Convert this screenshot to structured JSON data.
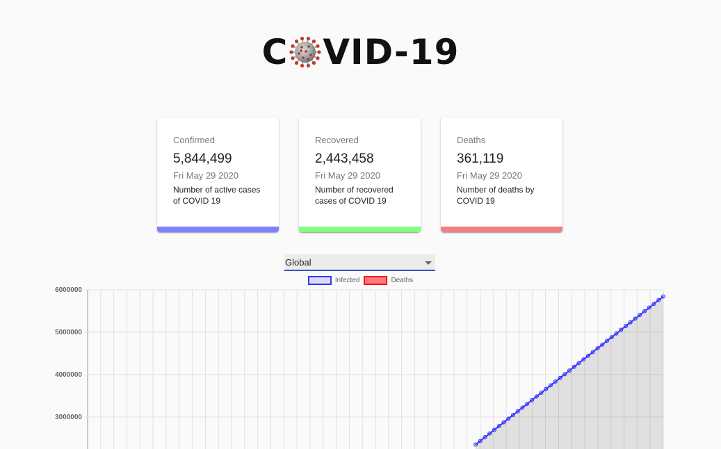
{
  "header": {
    "title_left": "C",
    "title_right": "VID-19",
    "logo_icon": "coronavirus-icon"
  },
  "cards": [
    {
      "title": "Confirmed",
      "value": "5,844,499",
      "date": "Fri May 29 2020",
      "description": "Number of active cases of COVID 19",
      "bar_color": "#8080ff"
    },
    {
      "title": "Recovered",
      "value": "2,443,458",
      "date": "Fri May 29 2020",
      "description": "Number of recovered cases of COVID 19",
      "bar_color": "#80ff80"
    },
    {
      "title": "Deaths",
      "value": "361,119",
      "date": "Fri May 29 2020",
      "description": "Number of deaths by COVID 19",
      "bar_color": "#f08080"
    }
  ],
  "country_select": {
    "selected": "Global",
    "icon": "chevron-down-icon"
  },
  "legend": {
    "infected": {
      "label": "Infected",
      "color": "#3333ff"
    },
    "deaths": {
      "label": "Deaths",
      "color": "#ff0000"
    }
  },
  "chart_data": {
    "type": "line",
    "y_ticks": [
      "6000000",
      "5000000",
      "4000000",
      "3000000"
    ],
    "ylim_visible": [
      2300000,
      6000000
    ],
    "series": [
      {
        "name": "Infected",
        "color": "#3333ff",
        "visible_trend": {
          "start": 2350000,
          "end": 5844499
        }
      },
      {
        "name": "Deaths",
        "color": "#ff0000"
      }
    ],
    "grid": true
  }
}
